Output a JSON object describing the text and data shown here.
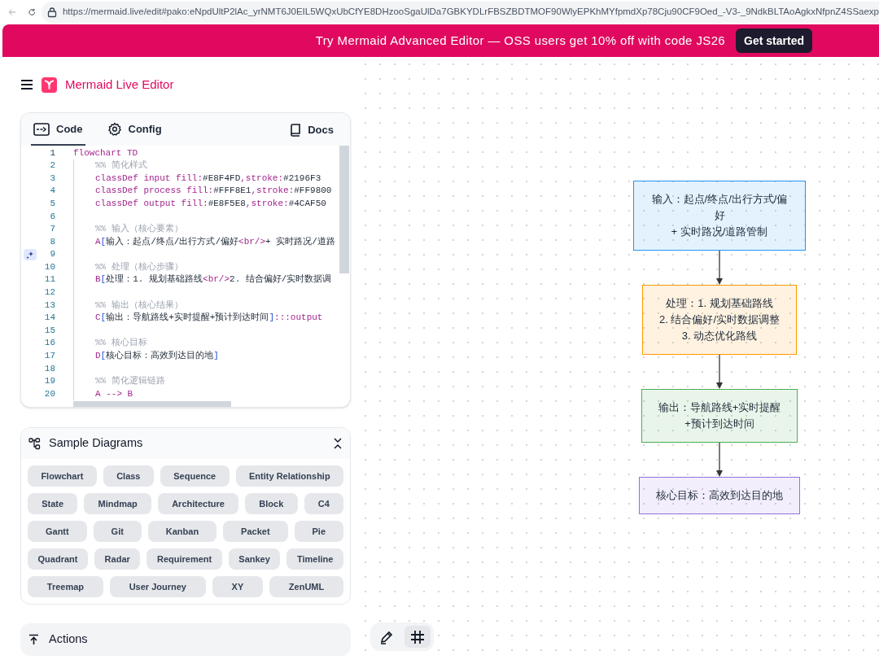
{
  "browser": {
    "url": "https://mermaid.live/edit#pako:eNpdUltP2lAc_yrNMT6J0EIL5WQxUbCfYE8DHzooSgaUlDa7GBKYDLrFBSZBDTMOF90WlyEPKhMYfpmdXp78Cju90CF9Oed_-V3-_9NdkBLTAoAgkxNfpnZ4SSaexp"
  },
  "banner": {
    "text": "Try Mermaid Advanced Editor — OSS users get 10% off with code JS26",
    "button": "Get started"
  },
  "app": {
    "title": "Mermaid Live Editor"
  },
  "editor": {
    "tabs": [
      {
        "label": "Code",
        "kind": "code",
        "selected": true
      },
      {
        "label": "Config",
        "kind": "config",
        "selected": false
      }
    ],
    "docs_link": "Docs",
    "lines": [
      {
        "number": "1",
        "indented": false,
        "tokens": [
          {
            "kind": "kw",
            "text": "flowchart TD"
          }
        ]
      },
      {
        "number": "2",
        "indented": true,
        "tokens": [
          {
            "kind": "comment",
            "text": "%% 简化样式"
          }
        ]
      },
      {
        "number": "3",
        "indented": true,
        "tokens": [
          {
            "kind": "kw",
            "text": "classDef input fill:"
          },
          {
            "kind": "text",
            "text": "#E8F4FD"
          },
          {
            "kind": "kw",
            "text": ",stroke:"
          },
          {
            "kind": "text",
            "text": "#2196F3"
          }
        ]
      },
      {
        "number": "4",
        "indented": true,
        "tokens": [
          {
            "kind": "kw",
            "text": "classDef process fill:"
          },
          {
            "kind": "text",
            "text": "#FFF8E1"
          },
          {
            "kind": "kw",
            "text": ",stroke:"
          },
          {
            "kind": "text",
            "text": "#FF9800"
          }
        ]
      },
      {
        "number": "5",
        "indented": true,
        "tokens": [
          {
            "kind": "kw",
            "text": "classDef output fill:"
          },
          {
            "kind": "text",
            "text": "#E8F5E8"
          },
          {
            "kind": "kw",
            "text": ",stroke:"
          },
          {
            "kind": "text",
            "text": "#4CAF50"
          }
        ]
      },
      {
        "number": "6",
        "indented": true
      },
      {
        "number": "7",
        "indented": true,
        "tokens": [
          {
            "kind": "comment",
            "text": "%% 输入（核心要素）"
          }
        ]
      },
      {
        "number": "8",
        "indented": true,
        "tokens": [
          {
            "kind": "kw",
            "text": "A"
          },
          {
            "kind": "bracket",
            "text": "["
          },
          {
            "kind": "text",
            "text": "输入：起点/终点/出行方式/偏好"
          },
          {
            "kind": "kw",
            "text": "<br/>"
          },
          {
            "kind": "text",
            "text": "+ 实时路况/道路"
          }
        ]
      },
      {
        "number": "9",
        "indented": true,
        "hint": true
      },
      {
        "number": "10",
        "indented": true,
        "tokens": [
          {
            "kind": "comment",
            "text": "%% 处理（核心步骤）"
          }
        ]
      },
      {
        "number": "11",
        "indented": true,
        "tokens": [
          {
            "kind": "kw",
            "text": "B"
          },
          {
            "kind": "bracket",
            "text": "["
          },
          {
            "kind": "text",
            "text": "处理：1. 规划基础路线"
          },
          {
            "kind": "kw",
            "text": "<br/>"
          },
          {
            "kind": "text",
            "text": "2. 结合偏好/实时数据调"
          }
        ]
      },
      {
        "number": "12",
        "indented": true
      },
      {
        "number": "13",
        "indented": true,
        "tokens": [
          {
            "kind": "comment",
            "text": "%% 输出（核心结果）"
          }
        ]
      },
      {
        "number": "14",
        "indented": true,
        "tokens": [
          {
            "kind": "kw",
            "text": "C"
          },
          {
            "kind": "bracket",
            "text": "["
          },
          {
            "kind": "text",
            "text": "输出：导航路线+实时提醒+预计到达时间"
          },
          {
            "kind": "bracket",
            "text": "]"
          },
          {
            "kind": "kw",
            "text": ":::output"
          }
        ]
      },
      {
        "number": "15",
        "indented": true
      },
      {
        "number": "16",
        "indented": true,
        "tokens": [
          {
            "kind": "comment",
            "text": "%% 核心目标"
          }
        ]
      },
      {
        "number": "17",
        "indented": true,
        "tokens": [
          {
            "kind": "kw",
            "text": "D"
          },
          {
            "kind": "bracket",
            "text": "["
          },
          {
            "kind": "text",
            "text": "核心目标：高效到达目的地"
          },
          {
            "kind": "bracket",
            "text": "]"
          }
        ]
      },
      {
        "number": "18",
        "indented": true
      },
      {
        "number": "19",
        "indented": true,
        "tokens": [
          {
            "kind": "comment",
            "text": "%% 简化逻辑链路"
          }
        ]
      },
      {
        "number": "20",
        "indented": true,
        "tokens": [
          {
            "kind": "kw",
            "text": "A --> B"
          }
        ]
      }
    ]
  },
  "samples": {
    "title": "Sample Diagrams",
    "rows": [
      [
        "Flowchart",
        "Class",
        "Sequence",
        "Entity Relationship"
      ],
      [
        "State",
        "Mindmap",
        "Architecture",
        "Block",
        "C4"
      ],
      [
        "Gantt",
        "Git",
        "Kanban",
        "Packet",
        "Pie"
      ],
      [
        "Quadrant",
        "Radar",
        "Requirement",
        "Sankey",
        "Timeline"
      ],
      [
        "Treemap",
        "User Journey",
        "XY",
        "ZenUML"
      ]
    ]
  },
  "actions": {
    "title": "Actions"
  },
  "canvas_toolbar": [
    {
      "kind": "pen",
      "selected": false
    },
    {
      "kind": "grid",
      "selected": true
    }
  ],
  "diagram": {
    "nodes": [
      {
        "lines": [
          "输入：起点/终点/出行方式/偏好",
          "+ 实时路况/道路管制"
        ],
        "color": "#2196F3"
      },
      {
        "lines": [
          "处理：1. 规划基础路线",
          "2. 结合偏好/实时数据调整",
          "3. 动态优化路线"
        ],
        "color": "#FF9800"
      },
      {
        "lines": [
          "输出：导航路线+实时提醒",
          "+预计到达时间"
        ],
        "color": "#4CAF50"
      },
      {
        "lines": [
          "核心目标：高效到达目的地"
        ],
        "color": "#9370DB"
      }
    ]
  }
}
